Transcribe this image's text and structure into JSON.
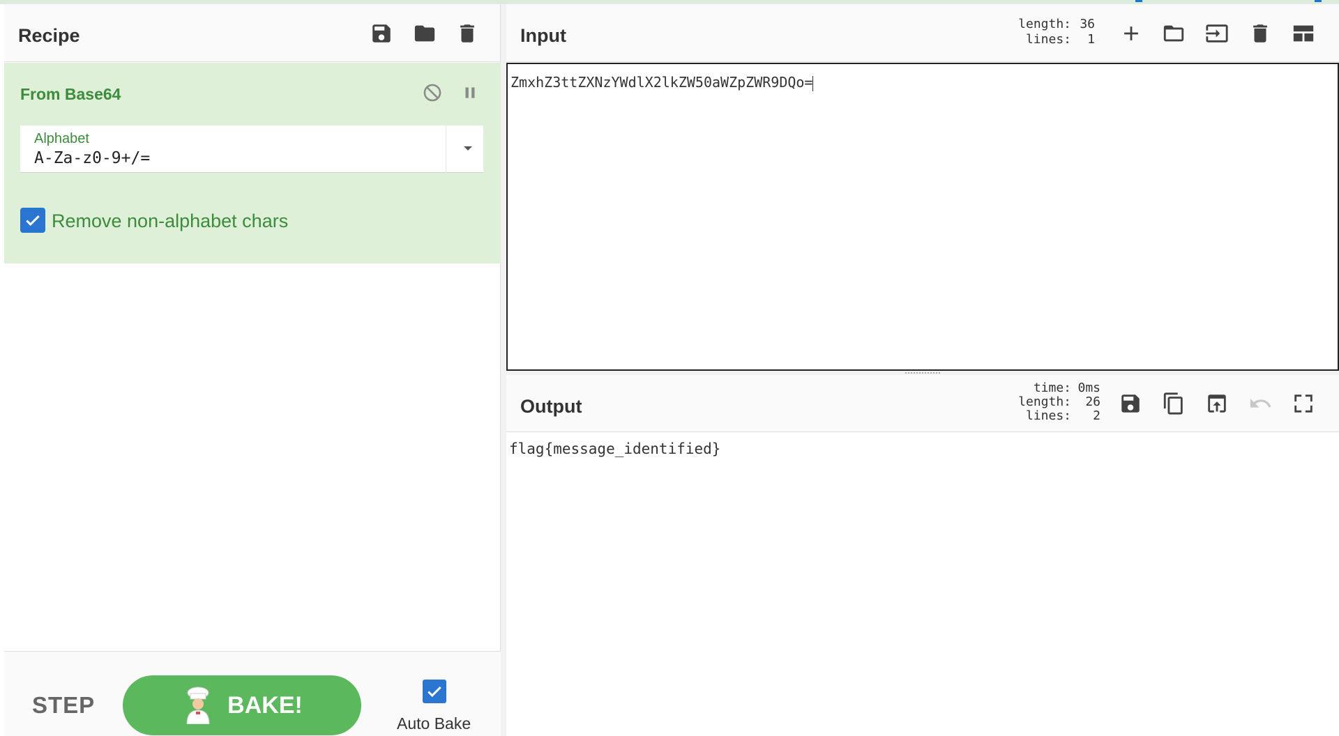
{
  "recipe": {
    "title": "Recipe",
    "operation": {
      "name": "From Base64",
      "alphabet_label": "Alphabet",
      "alphabet_value": "A-Za-z0-9+/=",
      "remove_non_alpha_label": "Remove non-alphabet chars",
      "remove_non_alpha_checked": true
    },
    "footer": {
      "step_label": "STEP",
      "bake_label": "BAKE!",
      "auto_bake_label": "Auto Bake",
      "auto_bake_checked": true
    }
  },
  "input": {
    "title": "Input",
    "length_label": "length:",
    "length_value": "36",
    "lines_label": "lines:",
    "lines_value": "1",
    "text": "ZmxhZ3ttZXNzYWdlX2lkZW50aWZpZWR9DQo="
  },
  "output": {
    "title": "Output",
    "time_label": "time:",
    "time_value": "0ms",
    "length_label": "length:",
    "length_value": "26",
    "lines_label": "lines:",
    "lines_value": "2",
    "text": "flag{message_identified}"
  },
  "icons": {
    "save": "save-icon",
    "open": "folder-icon",
    "delete": "trash-icon",
    "disable": "disable-icon",
    "pause": "pause-icon",
    "add": "plus-icon",
    "import": "import-icon",
    "layout": "layout-icon",
    "copy": "copy-icon",
    "replace": "replace-input-icon",
    "undo": "undo-icon",
    "maximize": "maximize-icon",
    "chef": "chef-icon"
  },
  "colors": {
    "operation_bg": "#dff0d8",
    "operation_text": "#3c8c3c",
    "bake_button": "#5cb85c",
    "checkbox": "#2a75d0"
  }
}
